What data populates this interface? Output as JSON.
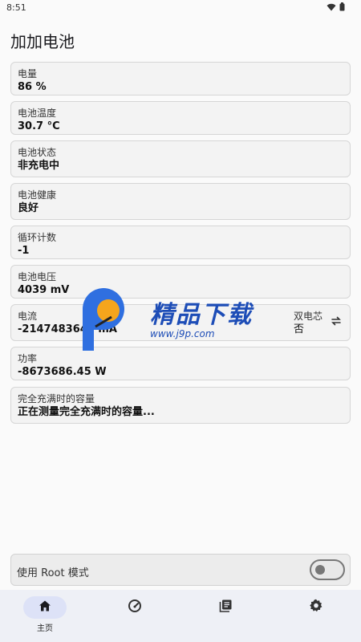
{
  "status_bar": {
    "time": "8:51"
  },
  "app": {
    "title": "加加电池"
  },
  "cards": {
    "level": {
      "label": "电量",
      "value": "86 %"
    },
    "temp": {
      "label": "电池温度",
      "value": "30.7 °C"
    },
    "status": {
      "label": "电池状态",
      "value": "非充电中"
    },
    "health": {
      "label": "电池健康",
      "value": "良好"
    },
    "cycle": {
      "label": "循环计数",
      "value": "-1"
    },
    "voltage": {
      "label": "电池电压",
      "value": "4039 mV"
    },
    "current": {
      "label": "电流",
      "value": "-2147483648 mA",
      "dual_label": "双电芯",
      "dual_value": "否"
    },
    "power": {
      "label": "功率",
      "value": "-8673686.45 W"
    },
    "full": {
      "label": "完全充满时的容量",
      "value": "正在测量完全充满时的容量..."
    }
  },
  "root_mode": {
    "label": "使用 Root 模式",
    "enabled": false
  },
  "bottom_nav": {
    "items": [
      {
        "icon": "home-icon",
        "label": "主页",
        "active": true
      },
      {
        "icon": "speedometer-icon",
        "label": "",
        "active": false
      },
      {
        "icon": "library-icon",
        "label": "",
        "active": false
      },
      {
        "icon": "gear-icon",
        "label": "",
        "active": false
      }
    ]
  },
  "watermark": {
    "text": "精品下载",
    "url": "www.j9p.com"
  },
  "colors": {
    "nav_bg": "#eef0f6",
    "nav_active": "#dde2f7",
    "watermark_blue": "#1d4db7",
    "watermark_orange": "#f5a51c"
  }
}
